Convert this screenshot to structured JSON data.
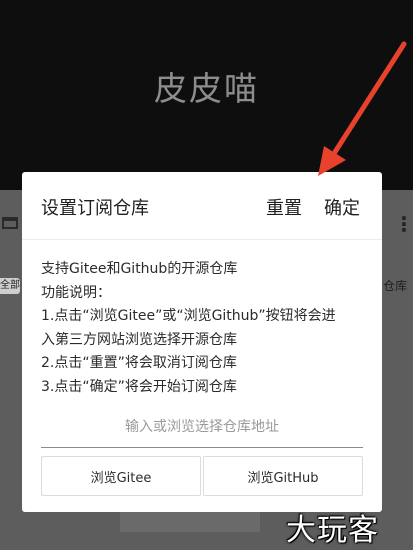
{
  "app": {
    "title": "皮皮喵"
  },
  "background": {
    "chip_left": "全部",
    "text_right": "仓库"
  },
  "dialog": {
    "title": "设置订阅仓库",
    "reset_label": "重置",
    "confirm_label": "确定",
    "description_lines": [
      "支持Gitee和Github的开源仓库",
      "功能说明：",
      "1.点击“浏览Gitee”或“浏览Github”按钮将会进",
      "入第三方网站浏览选择开源仓库",
      "2.点击“重置”将会取消订阅仓库",
      "3.点击“确定”将会开始订阅仓库"
    ],
    "input": {
      "value": "",
      "placeholder": "输入或浏览选择仓库地址"
    },
    "browse_gitee_label": "浏览Gitee",
    "browse_github_label": "浏览GitHub"
  },
  "watermark": "大玩客",
  "colors": {
    "annotation_arrow": "#e8412c",
    "header_bg": "#0e0e0e",
    "dialog_bg": "#ffffff"
  }
}
